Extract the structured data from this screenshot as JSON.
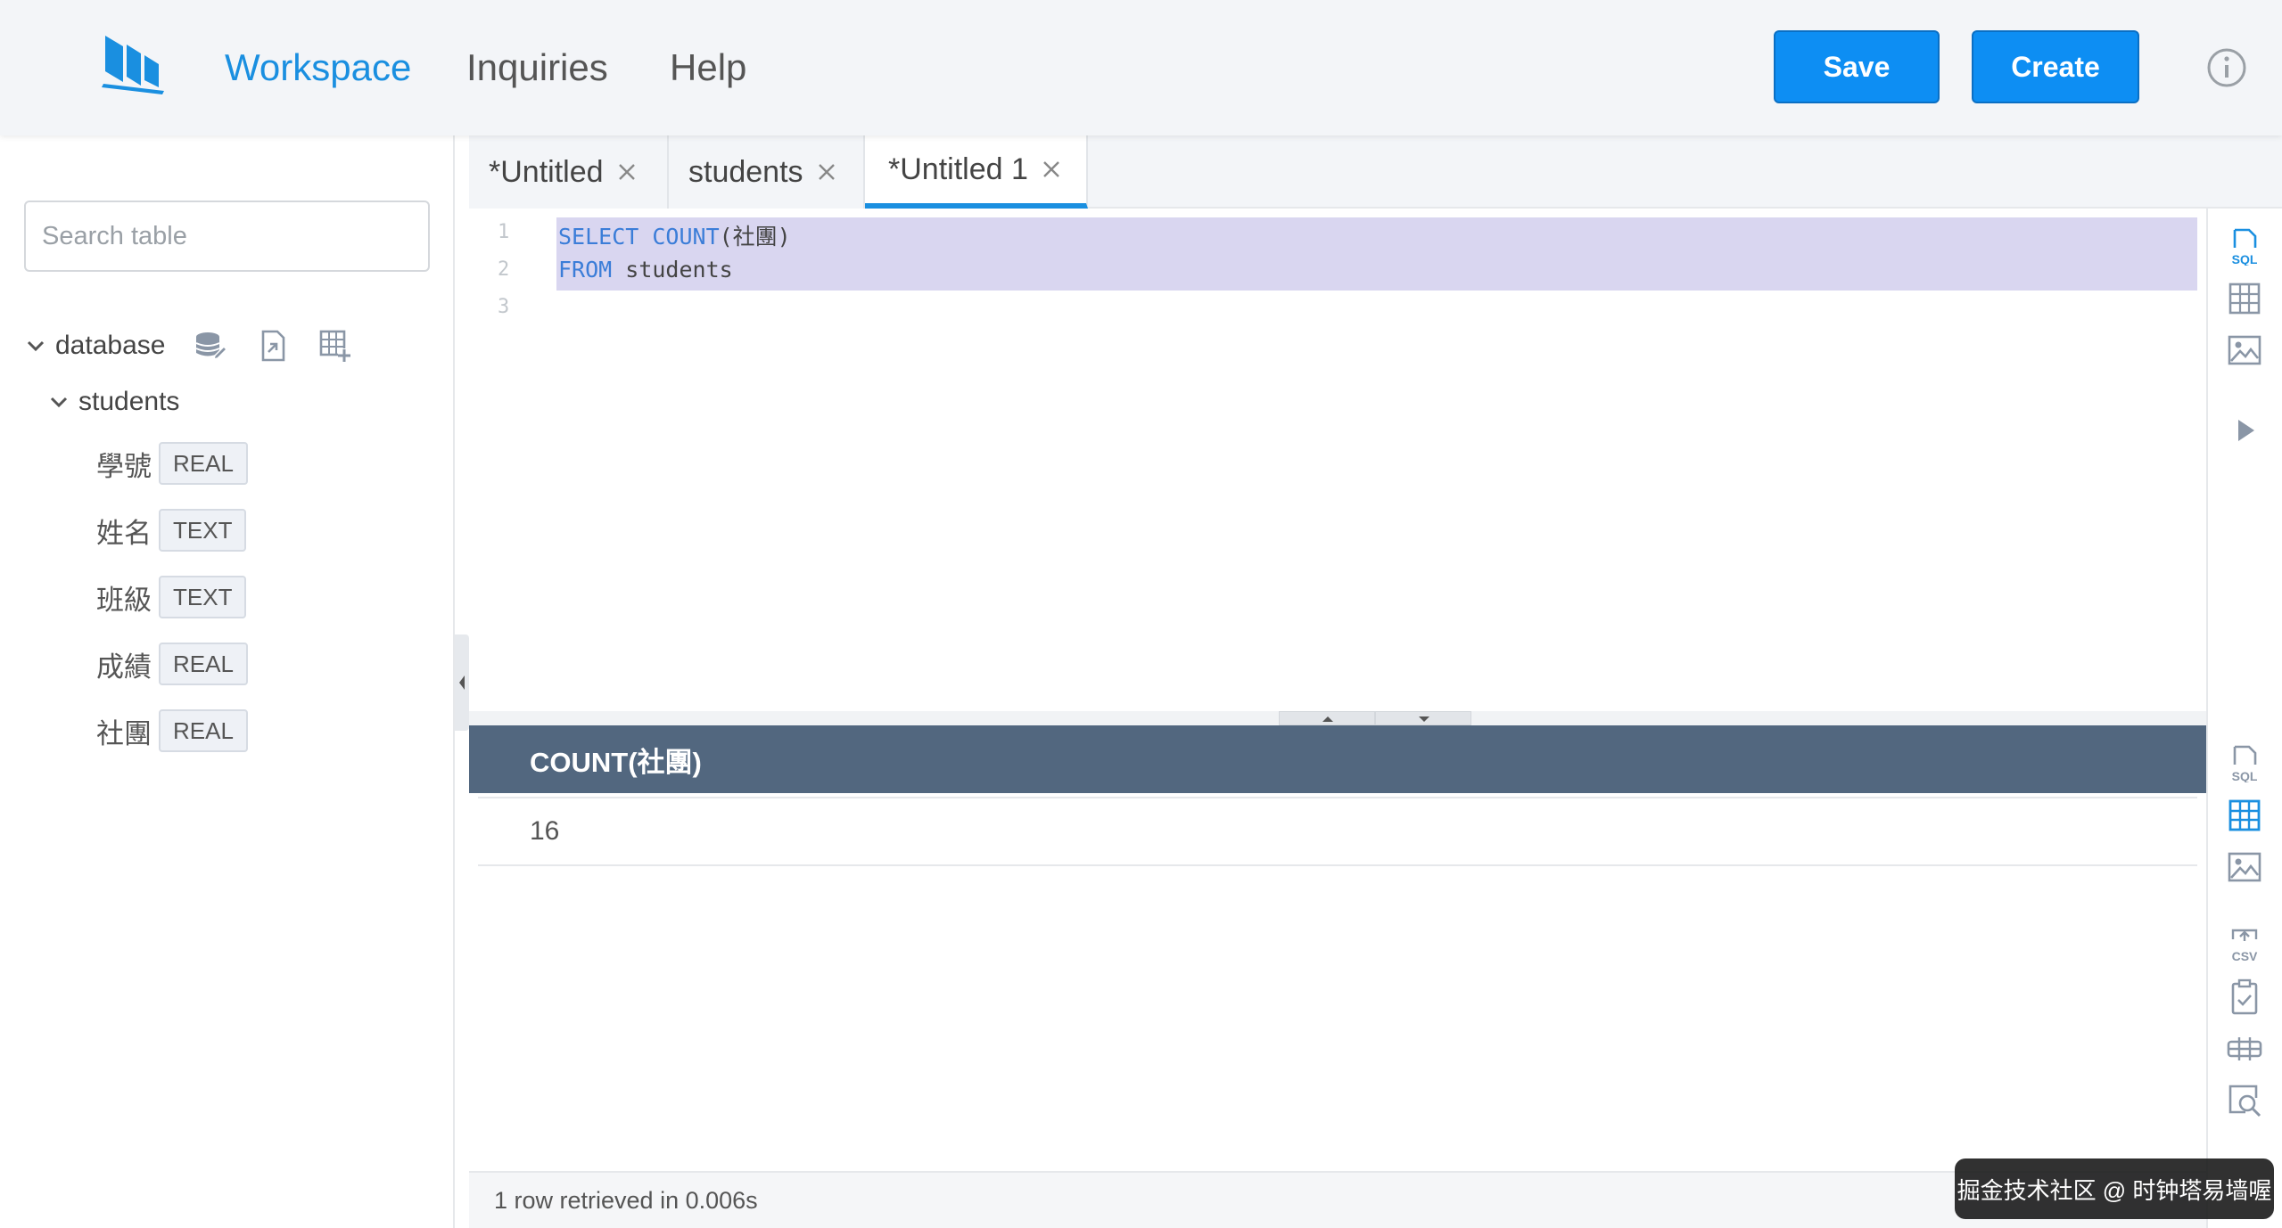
{
  "header": {
    "nav": [
      "Workspace",
      "Inquiries",
      "Help"
    ],
    "active_nav": "Workspace",
    "save_label": "Save",
    "create_label": "Create"
  },
  "sidebar": {
    "search_placeholder": "Search table",
    "database_label": "database",
    "table_label": "students",
    "columns": [
      {
        "name": "學號",
        "type": "REAL"
      },
      {
        "name": "姓名",
        "type": "TEXT"
      },
      {
        "name": "班級",
        "type": "TEXT"
      },
      {
        "name": "成績",
        "type": "REAL"
      },
      {
        "name": "社團",
        "type": "REAL"
      }
    ]
  },
  "tabs": [
    {
      "label": "*Untitled",
      "active": false
    },
    {
      "label": "students",
      "active": false
    },
    {
      "label": "*Untitled 1",
      "active": true
    }
  ],
  "editor": {
    "line_numbers": [
      "1",
      "2",
      "3"
    ],
    "lines": [
      {
        "keyword": "SELECT COUNT",
        "rest": "(社團)"
      },
      {
        "keyword": "FROM",
        "rest": " students"
      },
      {
        "keyword": "",
        "rest": ""
      }
    ]
  },
  "results": {
    "column_header": "COUNT(社團)",
    "rows": [
      "16"
    ],
    "status": "1 row retrieved in 0.006s"
  },
  "watermark": "掘金技术社区 @ 时钟塔易墙喔",
  "colors": {
    "accent": "#1a8fe0",
    "button": "#0d8ef3",
    "results_header": "#52677f",
    "selection": "#d9d6f0"
  },
  "icons": {
    "rail_top": [
      "sql-icon",
      "table-icon",
      "image-icon",
      "play-icon"
    ],
    "rail_bottom": [
      "sql-icon",
      "table-icon",
      "image-icon",
      "csv-export-icon",
      "clipboard-icon",
      "column-layout-icon",
      "search-preview-icon"
    ]
  }
}
